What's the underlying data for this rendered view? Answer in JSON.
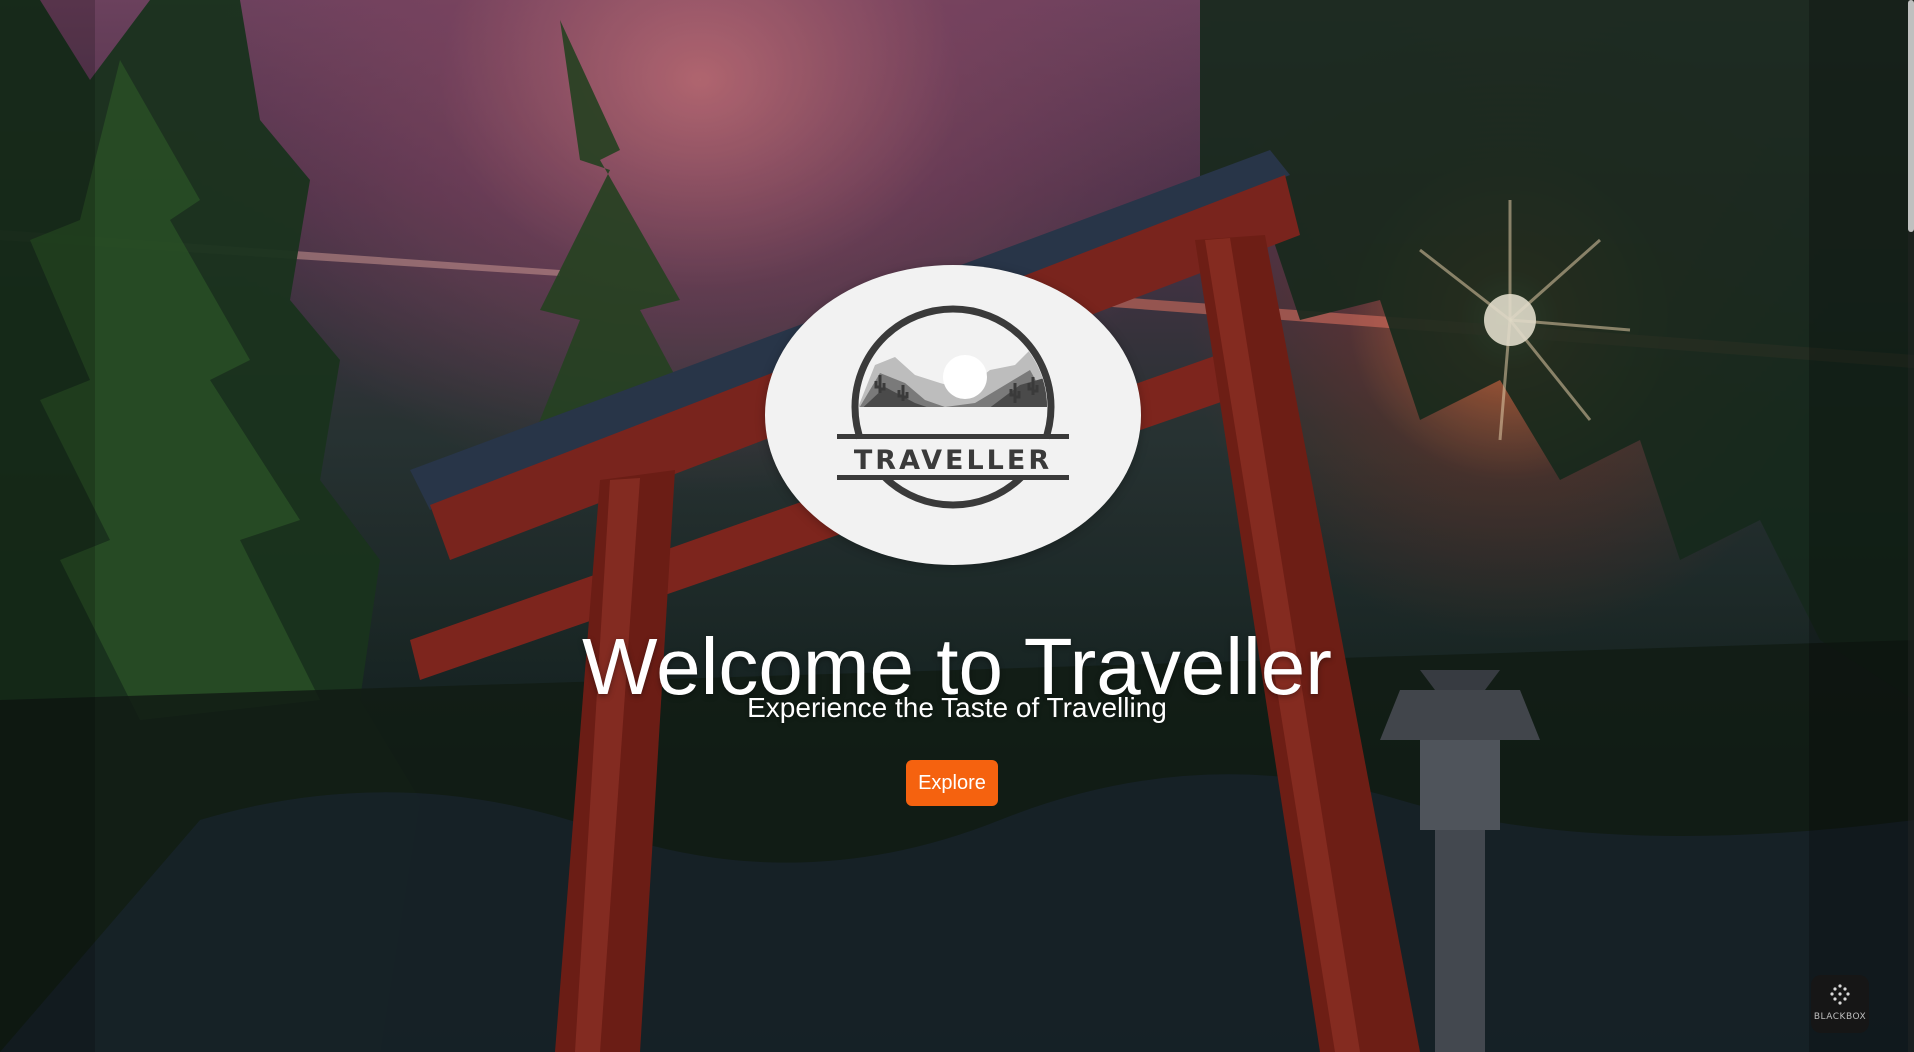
{
  "logo": {
    "brand_text": "TRAVELLER"
  },
  "hero": {
    "title": "Welcome to Traveller",
    "subtitle": "Experience the Taste of Travelling",
    "cta_label": "Explore"
  },
  "colors": {
    "cta_background": "#f5620f",
    "text": "#ffffff",
    "logo_background": "#f2f2f2",
    "logo_ink": "#3a3a3a"
  },
  "widget": {
    "label": "BLACKBOX",
    "icon": "blackbox-dots-icon"
  },
  "background": {
    "icon": "torii-gate-scenery"
  }
}
